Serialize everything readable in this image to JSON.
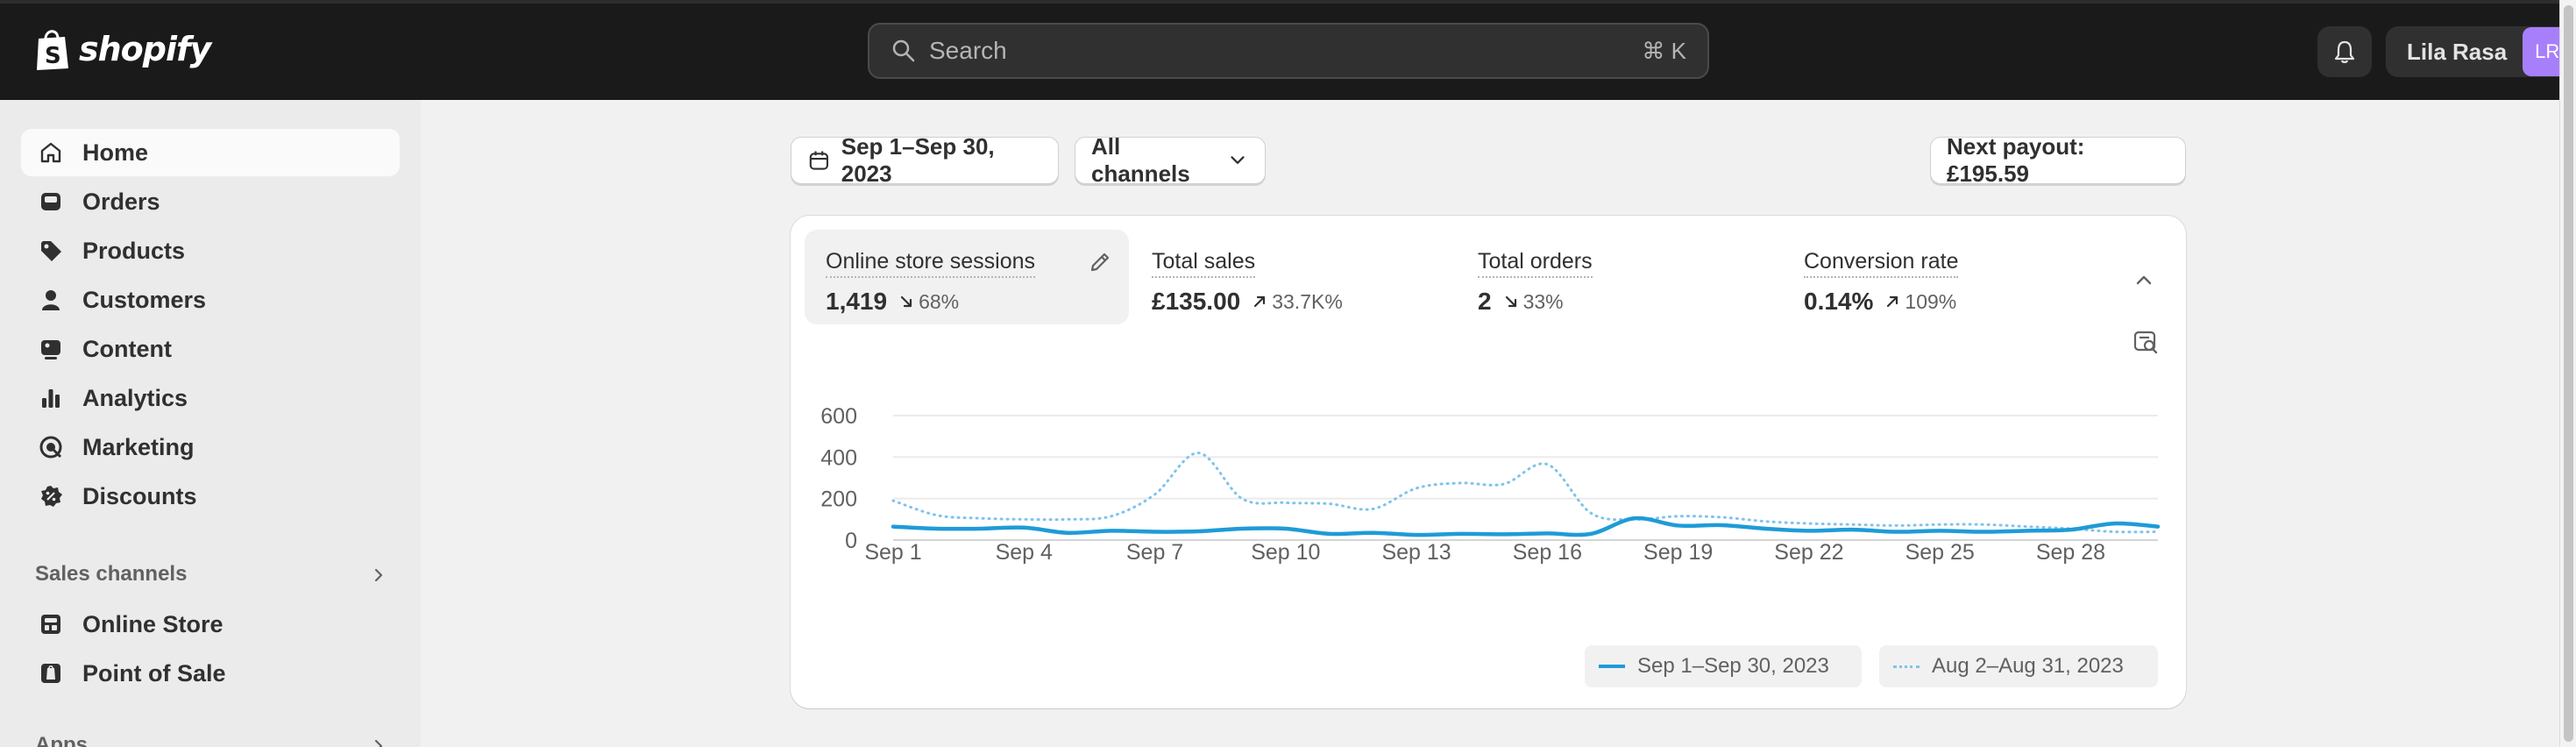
{
  "topbar": {
    "brand": "shopify",
    "search_placeholder": "Search",
    "search_shortcut": "⌘ K",
    "bell_icon": "bell-icon",
    "user_name": "Lila Rasa",
    "user_initials": "LR",
    "avatar_color": "#a87ffb"
  },
  "sidebar": {
    "items": [
      {
        "label": "Home",
        "icon": "home-icon",
        "active": true
      },
      {
        "label": "Orders",
        "icon": "inbox-icon"
      },
      {
        "label": "Products",
        "icon": "tag-icon"
      },
      {
        "label": "Customers",
        "icon": "person-icon"
      },
      {
        "label": "Content",
        "icon": "image-icon"
      },
      {
        "label": "Analytics",
        "icon": "bar-chart-icon"
      },
      {
        "label": "Marketing",
        "icon": "target-icon"
      },
      {
        "label": "Discounts",
        "icon": "discount-icon"
      }
    ],
    "sales_channels_title": "Sales channels",
    "channels": [
      {
        "label": "Online Store",
        "icon": "store-icon"
      },
      {
        "label": "Point of Sale",
        "icon": "pos-icon"
      }
    ],
    "apps_title": "Apps"
  },
  "toolbar": {
    "date_range": "Sep 1–Sep 30, 2023",
    "channels_filter": "All channels",
    "next_payout": "Next payout: £195.59"
  },
  "metrics": [
    {
      "title": "Online store sessions",
      "value": "1,419",
      "change": "68%",
      "direction": "down",
      "active": true
    },
    {
      "title": "Total sales",
      "value": "£135.00",
      "change": "33.7K%",
      "direction": "up"
    },
    {
      "title": "Total orders",
      "value": "2",
      "change": "33%",
      "direction": "down"
    },
    {
      "title": "Conversion rate",
      "value": "0.14%",
      "change": "109%",
      "direction": "up"
    }
  ],
  "chart_data": {
    "type": "line",
    "title": "",
    "xlabel": "",
    "ylabel": "",
    "ylim": [
      0,
      600
    ],
    "yticks": [
      0,
      200,
      400,
      600
    ],
    "grid": true,
    "legend_placement": "bottom-right",
    "x_tick_labels": [
      "Sep 1",
      "Sep 4",
      "Sep 7",
      "Sep 10",
      "Sep 13",
      "Sep 16",
      "Sep 19",
      "Sep 22",
      "Sep 25",
      "Sep 28"
    ],
    "x_days": [
      1,
      2,
      3,
      4,
      5,
      6,
      7,
      8,
      9,
      10,
      11,
      12,
      13,
      14,
      15,
      16,
      17,
      18,
      19,
      20,
      21,
      22,
      23,
      24,
      25,
      26,
      27,
      28,
      29,
      30
    ],
    "series": [
      {
        "name": "Sep 1–Sep 30, 2023",
        "style": "solid",
        "color": "#1f9bd7",
        "values": [
          65,
          55,
          55,
          60,
          35,
          45,
          40,
          42,
          55,
          55,
          30,
          35,
          25,
          30,
          28,
          32,
          30,
          105,
          70,
          72,
          55,
          45,
          50,
          40,
          45,
          40,
          45,
          50,
          80,
          65
        ]
      },
      {
        "name": "Aug 2–Aug 31, 2023",
        "style": "dotted",
        "color": "#7ec3ec",
        "values": [
          190,
          120,
          105,
          100,
          100,
          115,
          220,
          420,
          200,
          180,
          175,
          150,
          250,
          275,
          270,
          365,
          130,
          100,
          115,
          110,
          90,
          80,
          75,
          70,
          75,
          75,
          65,
          55,
          40,
          40
        ]
      }
    ]
  }
}
